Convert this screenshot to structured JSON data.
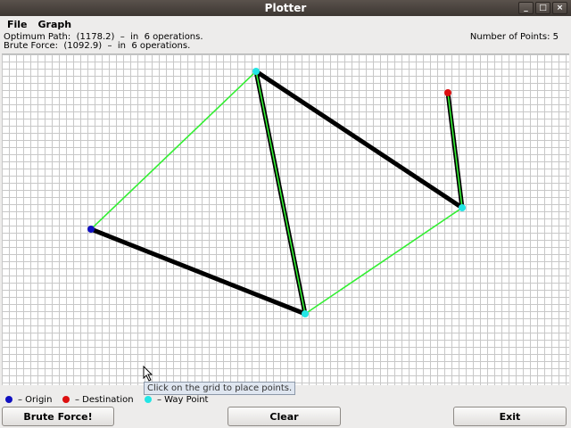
{
  "window": {
    "title": "Plotter",
    "buttons": [
      "_",
      "□",
      "×"
    ]
  },
  "menu": [
    "File",
    "Graph"
  ],
  "info": {
    "optimum": "Optimum Path:  (1178.2)  –  in  6 operations.",
    "brute": "Brute Force:  (1092.9)  –  in  6 operations.",
    "num_points": "Number of Points: 5"
  },
  "points": {
    "origin": [
      100,
      196
    ],
    "destination": [
      500,
      43
    ],
    "waypoints": [
      [
        285,
        19
      ],
      [
        516,
        172
      ],
      [
        340,
        291
      ]
    ]
  },
  "paths": {
    "optimum": [
      [
        100,
        196
      ],
      [
        285,
        19
      ],
      [
        340,
        291
      ],
      [
        516,
        172
      ],
      [
        500,
        43
      ]
    ],
    "brute": [
      [
        100,
        196
      ],
      [
        340,
        291
      ],
      [
        285,
        19
      ],
      [
        516,
        172
      ],
      [
        500,
        43
      ]
    ]
  },
  "colors": {
    "optimum": "#33ee33",
    "brute": "#000000",
    "origin": "#1010c0",
    "destination": "#dd1010",
    "waypoint": "#22e5e5"
  },
  "tooltip": "Click on the grid to place points.",
  "legend": {
    "origin": "– Origin",
    "destination": "– Destination",
    "waypoint": "– Way Point"
  },
  "buttons": {
    "brute": "Brute Force!",
    "clear": "Clear",
    "exit": "Exit"
  }
}
